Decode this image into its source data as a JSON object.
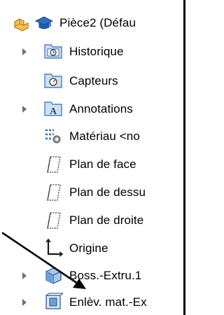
{
  "tree": {
    "root": {
      "label": "Pièce2 (Défau"
    },
    "items": [
      {
        "label": "Historique",
        "has_children": true,
        "icon": "history-folder-icon"
      },
      {
        "label": "Capteurs",
        "has_children": false,
        "icon": "sensors-folder-icon"
      },
      {
        "label": "Annotations",
        "has_children": true,
        "icon": "annotations-icon"
      },
      {
        "label": "Matériau <no",
        "has_children": false,
        "icon": "material-icon"
      },
      {
        "label": "Plan de face",
        "has_children": false,
        "icon": "plane-icon"
      },
      {
        "label": "Plan de dessu",
        "has_children": false,
        "icon": "plane-icon"
      },
      {
        "label": "Plan de droite",
        "has_children": false,
        "icon": "plane-icon"
      },
      {
        "label": "Origine",
        "has_children": false,
        "icon": "origin-icon"
      },
      {
        "label": "Boss.-Extru.1",
        "has_children": true,
        "icon": "extrude-boss-icon"
      },
      {
        "label": "Enlèv. mat.-Ex",
        "has_children": true,
        "icon": "extrude-cut-icon"
      }
    ]
  },
  "colors": {
    "part_icon_orange": "#E8A33B",
    "mortarboard_blue": "#1F5FA8",
    "folder_blue": "#2F6DB5",
    "expander_gray": "#6F6F6F",
    "pointer_arrow": "#000000"
  }
}
